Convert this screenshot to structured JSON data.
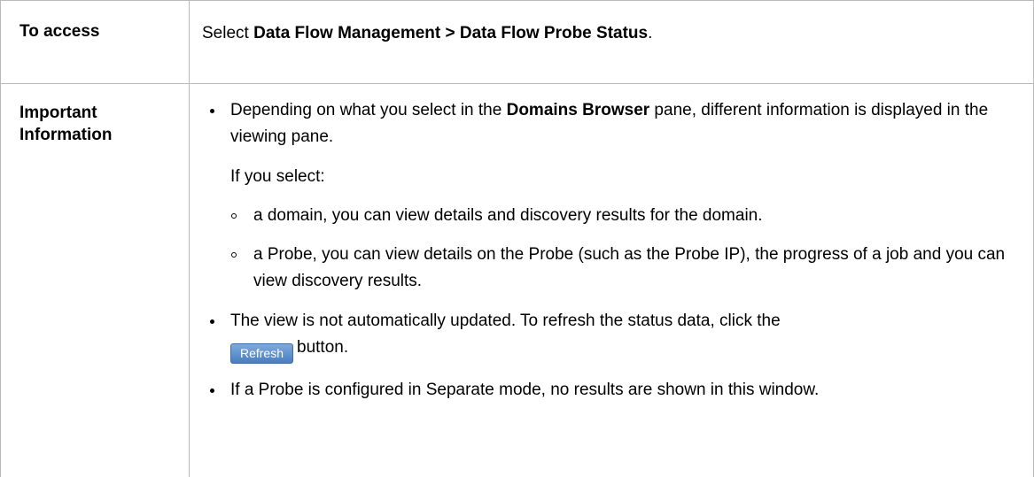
{
  "table": {
    "row_access": {
      "header": "To access",
      "text_prefix": "Select ",
      "menu_path": "Data Flow Management > Data Flow Probe Status",
      "text_suffix": "."
    },
    "row_info": {
      "header_line1": "Important",
      "header_line2": "Information",
      "bullet1": {
        "text_prefix": "Depending on what you select in the ",
        "bold": "Domains Browser",
        "text_suffix": " pane, different information is displayed in the viewing pane.",
        "if_select": "If you select:",
        "sub_items": [
          "a domain, you can view details and discovery results for the domain.",
          "a Probe, you can view details on the Probe (such as the Probe IP), the progress of a job and you can view discovery results."
        ]
      },
      "bullet2": {
        "text": "The view is not automatically updated. To refresh the status data, click the",
        "button_label": "Refresh",
        "after_button": "button."
      },
      "bullet3": {
        "text": "If a Probe is configured in Separate mode, no results are shown in this window."
      }
    }
  },
  "colors": {
    "border": "#b9b9b9",
    "button_top": "#7fa9dc",
    "button_bottom": "#4a7ec0",
    "text": "#000000"
  }
}
